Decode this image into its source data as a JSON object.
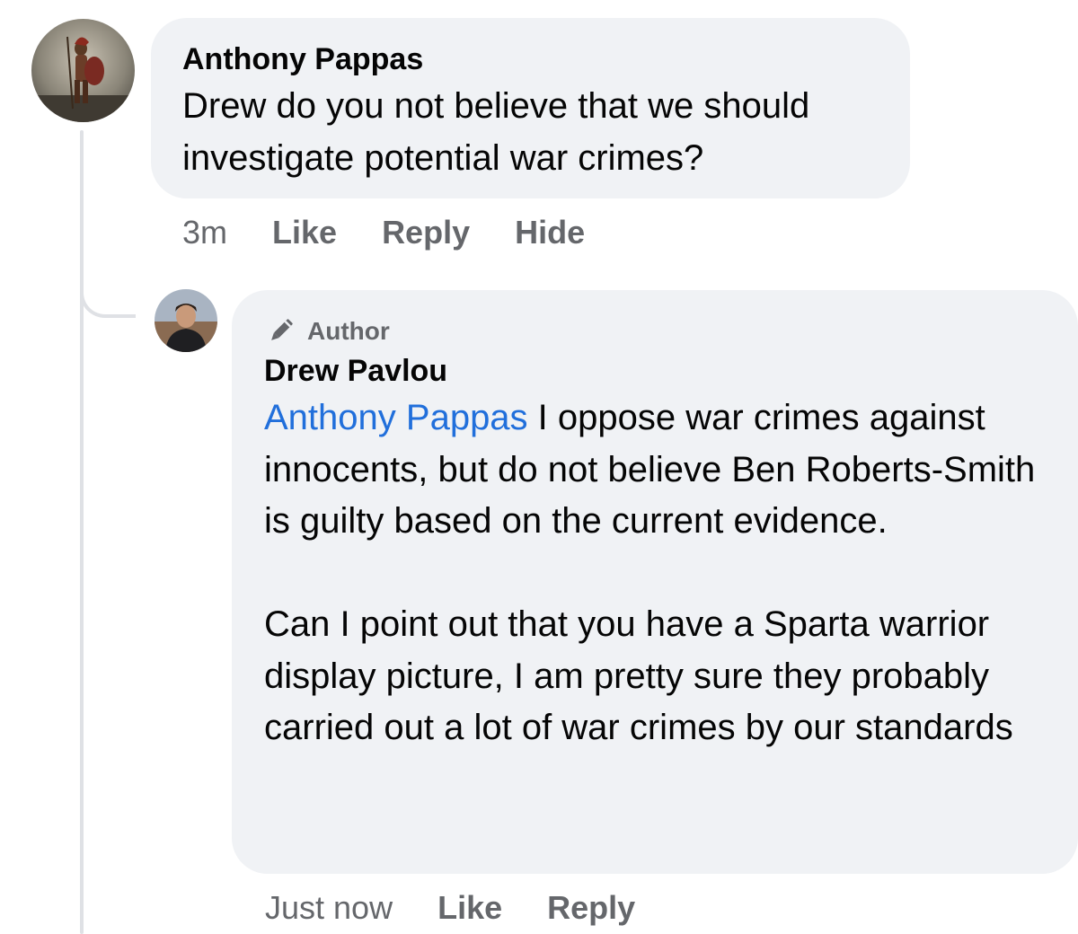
{
  "comments": [
    {
      "author": "Anthony Pappas",
      "avatar_icon": "spartan-warrior-avatar",
      "text": "Drew do you not believe that we should investigate potential war crimes?",
      "time": "3m",
      "actions": [
        "Like",
        "Reply",
        "Hide"
      ]
    },
    {
      "badge_icon": "pen-icon",
      "badge": "Author",
      "author": "Drew Pavlou",
      "avatar_icon": "profile-photo-avatar",
      "mention": "Anthony Pappas",
      "text": " I oppose war crimes against innocents, but do not believe Ben Roberts-Smith is guilty based on the current evidence.",
      "text2": "Can I point out that you have a Sparta warrior display picture, I am pretty sure they probably carried out a lot of war crimes by our standards",
      "time": "Just now",
      "actions": [
        "Like",
        "Reply"
      ]
    }
  ],
  "colors": {
    "bubble": "#f0f2f5",
    "text": "#050505",
    "secondary": "#65676b",
    "mention": "#216fdb",
    "thread_line": "#dfe1e5"
  }
}
